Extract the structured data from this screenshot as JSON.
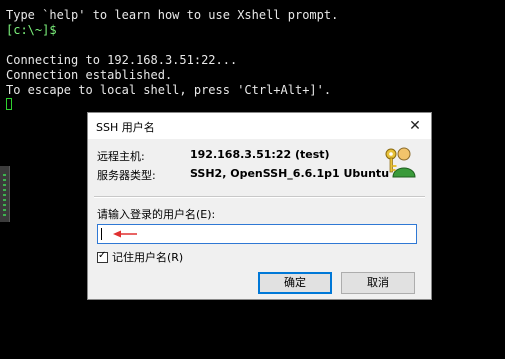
{
  "terminal": {
    "help_line": "Type `help' to learn how to use Xshell prompt.",
    "prompt": "[c:\\~]$",
    "connecting_line": "Connecting to 192.168.3.51:22...",
    "established_line": "Connection established.",
    "escape_line": "To escape to local shell, press 'Ctrl+Alt+]'."
  },
  "dialog": {
    "title": "SSH 用户名",
    "close_glyph": "✕",
    "remote_host_label": "远程主机:",
    "remote_host_value": "192.168.3.51:22 (test)",
    "server_type_label": "服务器类型:",
    "server_type_value": "SSH2, OpenSSH_6.6.1p1 Ubuntu",
    "username_prompt": "请输入登录的用户名(E):",
    "username_value": "",
    "remember_label": "记住用户名(R)",
    "remember_checked": true,
    "ok_label": "确定",
    "cancel_label": "取消",
    "icon": "keys-user-icon"
  },
  "colors": {
    "terminal_bg": "#000000",
    "prompt": "#7cf27c",
    "focus_border": "#2f78d4",
    "annotation_arrow": "#e03030"
  }
}
